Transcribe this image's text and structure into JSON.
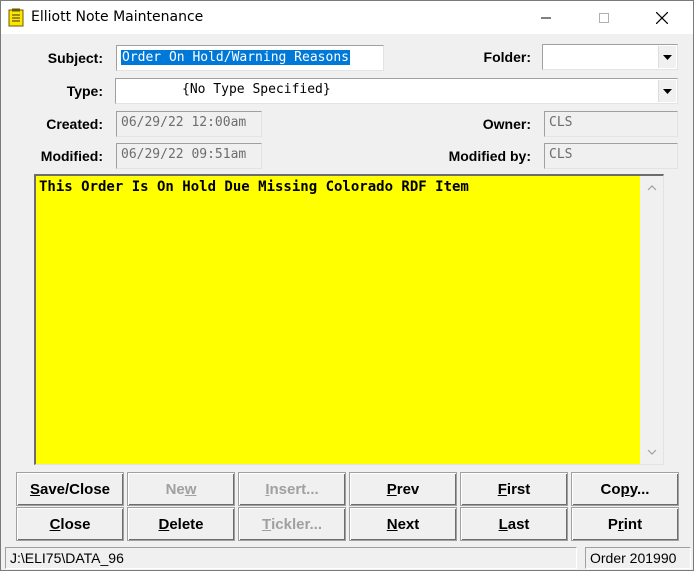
{
  "window": {
    "title": "Elliott Note Maintenance"
  },
  "icons": {
    "app": "note-icon",
    "minimize": "minimize-icon",
    "maximize": "maximize-icon",
    "close": "close-icon",
    "dropdown": "chevron-down-icon"
  },
  "form": {
    "subject_label": "Subject:",
    "subject_value": "Order On Hold/Warning Reasons",
    "folder_label": "Folder:",
    "folder_value": "",
    "type_label": "Type:",
    "type_value": "{No Type Specified}",
    "created_label": "Created:",
    "created_value": "06/29/22 12:00am",
    "owner_label": "Owner:",
    "owner_value": "CLS",
    "modified_label": "Modified:",
    "modified_value": "06/29/22 09:51am",
    "modified_by_label": "Modified by:",
    "modified_by_value": "CLS"
  },
  "note": {
    "text": "This Order Is On Hold Due Missing Colorado RDF Item",
    "background": "#ffff00"
  },
  "buttons": {
    "save_close": {
      "pre": "",
      "key": "S",
      "post": "ave/Close"
    },
    "new": {
      "pre": "Ne",
      "key": "w",
      "post": ""
    },
    "insert": {
      "pre": "",
      "key": "I",
      "post": "nsert..."
    },
    "prev": {
      "pre": "",
      "key": "P",
      "post": "rev"
    },
    "first": {
      "pre": "",
      "key": "F",
      "post": "irst"
    },
    "copy": {
      "pre": "Co",
      "key": "p",
      "post": "y..."
    },
    "close": {
      "pre": "",
      "key": "C",
      "post": "lose"
    },
    "delete": {
      "pre": "",
      "key": "D",
      "post": "elete"
    },
    "tickler": {
      "pre": "",
      "key": "T",
      "post": "ickler..."
    },
    "next": {
      "pre": "",
      "key": "N",
      "post": "ext"
    },
    "last": {
      "pre": "",
      "key": "L",
      "post": "ast"
    },
    "print": {
      "pre": "P",
      "key": "r",
      "post": "int"
    }
  },
  "status": {
    "path": "J:\\ELI75\\DATA_96",
    "order": "Order 201990"
  }
}
